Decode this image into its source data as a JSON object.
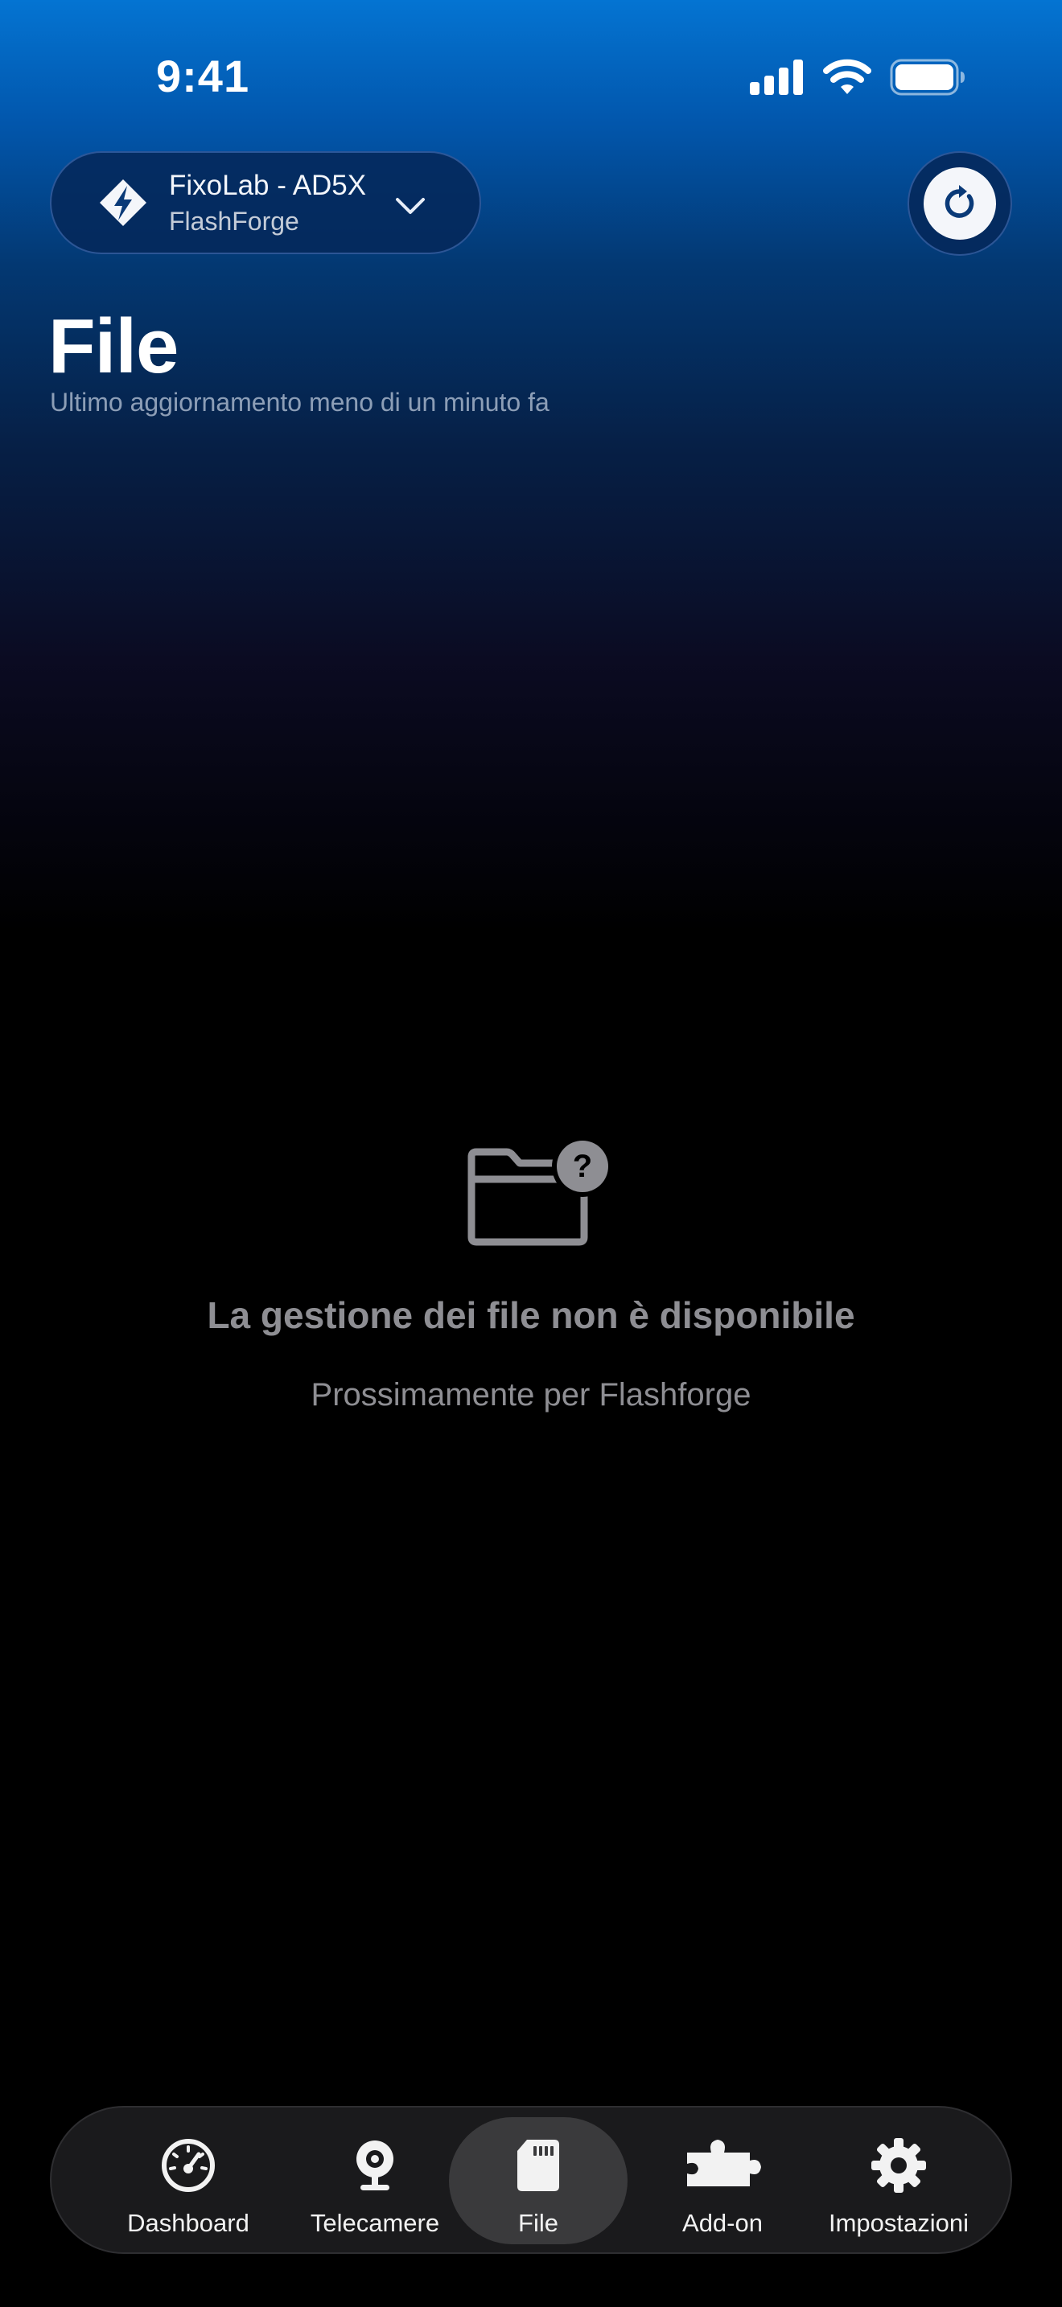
{
  "status_bar": {
    "time": "9:41"
  },
  "header": {
    "printer_name": "FixoLab - AD5X",
    "printer_brand": "FlashForge",
    "title": "File",
    "last_updated": "Ultimo aggiornamento meno di un minuto fa"
  },
  "empty_state": {
    "icon": "folder-question-icon",
    "title": "La gestione dei file non è disponibile",
    "subtitle": "Prossimamente per Flashforge"
  },
  "tab_bar": {
    "active": "File",
    "tabs": [
      {
        "label": "Dashboard",
        "icon": "gauge-icon"
      },
      {
        "label": "Telecamere",
        "icon": "webcam-icon"
      },
      {
        "label": "File",
        "icon": "sd-card-icon"
      },
      {
        "label": "Add-on",
        "icon": "puzzle-icon"
      },
      {
        "label": "Impostazioni",
        "icon": "gear-icon"
      }
    ]
  },
  "colors": {
    "gradient_top": "#0474d2",
    "background": "#000000",
    "muted_text": "#8e8e93",
    "tab_bar_bg": "#1a1a1c",
    "active_tab_bg": "#3a3a3c"
  }
}
